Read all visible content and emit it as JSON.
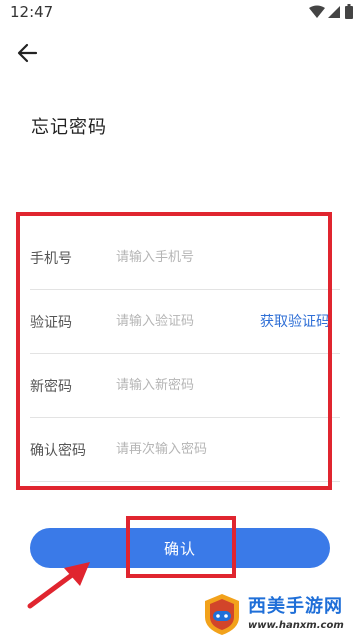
{
  "status_bar": {
    "time": "12:47"
  },
  "header": {
    "title": "忘记密码"
  },
  "form": {
    "rows": [
      {
        "label": "手机号",
        "placeholder": "请输入手机号"
      },
      {
        "label": "验证码",
        "placeholder": "请输入验证码",
        "action": "获取验证码"
      },
      {
        "label": "新密码",
        "placeholder": "请输入新密码"
      },
      {
        "label": "确认密码",
        "placeholder": "请再次输入密码"
      }
    ]
  },
  "confirm_button": {
    "label": "确认"
  },
  "watermark": {
    "title": "西美手游网",
    "url": "www.hanxm.com"
  },
  "colors": {
    "accent": "#3a7ae8",
    "link": "#2f6fd6",
    "annotation": "#e0252f"
  }
}
